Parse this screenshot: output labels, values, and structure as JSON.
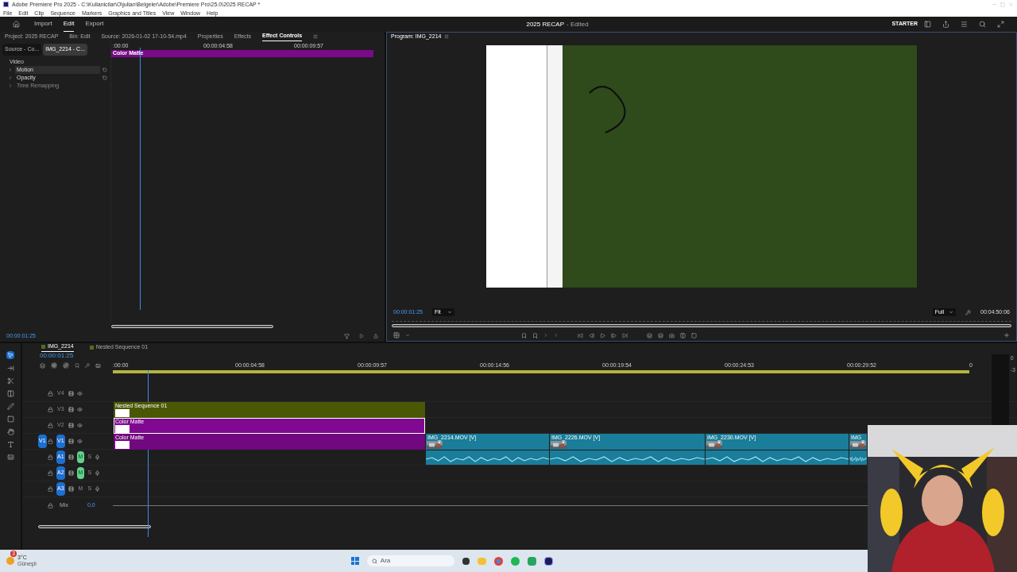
{
  "title_bar": {
    "title": "Adobe Premiere Pro 2025 - C:\\Kullanicilar\\O\\julian\\Belgeler\\Adobe\\Premiere Pro\\25.0\\2025 RECAP *"
  },
  "menu": [
    "File",
    "Edit",
    "Clip",
    "Sequence",
    "Markers",
    "Graphics and Titles",
    "View",
    "Window",
    "Help"
  ],
  "header": {
    "nav": [
      {
        "label": "Import",
        "selected": false
      },
      {
        "label": "Edit",
        "selected": true
      },
      {
        "label": "Export",
        "selected": false
      }
    ],
    "project_title": "2025 RECAP",
    "status": "- Edited",
    "workspace": "STARTER"
  },
  "left_panel": {
    "tabs": [
      {
        "label": "Project: 2025 RECAP",
        "selected": false
      },
      {
        "label": "Bin: Edit",
        "selected": false
      },
      {
        "label": "Source: 2026-01-02 17-10-54.mp4",
        "selected": false
      },
      {
        "label": "Properties",
        "selected": false
      },
      {
        "label": "Effects",
        "selected": false
      },
      {
        "label": "Effect Controls",
        "selected": true
      }
    ],
    "source_tabs": [
      {
        "label": "Source - Co...",
        "selected": false
      },
      {
        "label": "IMG_2214 - C...",
        "selected": true
      }
    ],
    "section": "Video",
    "effects": [
      {
        "name": "Motion",
        "selected": true,
        "enabled": true
      },
      {
        "name": "Opacity",
        "selected": false,
        "enabled": true
      },
      {
        "name": "Time Remapping",
        "selected": false,
        "enabled": false
      }
    ],
    "ruler": [
      ":00:00",
      "00:00:04:58",
      "00:00:09:57"
    ],
    "clip": {
      "name": "Color Matte",
      "color": "#7a0a8a"
    },
    "timecode": "00:00:01:25"
  },
  "program": {
    "title": "Program: IMG_2214",
    "timecode": "00:00:01:25",
    "zoom": "Fit",
    "resolution": "Full",
    "duration": "00:04:50:06"
  },
  "timeline": {
    "tabs": [
      {
        "label": "IMG_2214",
        "selected": true
      },
      {
        "label": "Nested Sequence 01",
        "selected": false
      }
    ],
    "timecode": "00:00:01:25",
    "snap": true,
    "linked": true,
    "ruler": [
      ":00:00",
      "00:00:04:58",
      "00:00:09:57",
      "00:00:14:56",
      "00:00:19:54",
      "00:00:24:53",
      "00:00:29:52",
      "0"
    ],
    "tracks": [
      {
        "label": "V4",
        "kind": "video",
        "targeted": false
      },
      {
        "label": "V3",
        "kind": "video",
        "targeted": false,
        "clips": [
          {
            "name": "Nested Sequence 01",
            "color": "#4a5806",
            "selected": false
          }
        ]
      },
      {
        "label": "V2",
        "kind": "video",
        "targeted": false,
        "clips": [
          {
            "name": "Color Matte",
            "color": "#7f0a8f",
            "selected": true
          }
        ]
      },
      {
        "label": "V1",
        "kind": "video",
        "targeted": true,
        "source": "V1",
        "clips": [
          {
            "name": "Color Matte",
            "color": "#72087f",
            "selected": false
          },
          {
            "name": "IMG_2214.MOV [V]",
            "color": "#1a7d99",
            "selected": false
          },
          {
            "name": "IMG_2226.MOV [V]",
            "color": "#1a7d99",
            "selected": false
          },
          {
            "name": "IMG_2230.MOV [V]",
            "color": "#1a7d99",
            "selected": false
          },
          {
            "name": "IMG_",
            "color": "#1a7d99",
            "selected": false
          }
        ]
      },
      {
        "label": "A1",
        "kind": "audio",
        "targeted": true,
        "mute": "M",
        "solo": "S",
        "muted": true,
        "clips": [
          {
            "color": "#1a7d99",
            "selected": false
          },
          {
            "color": "#1a7d99",
            "selected": false
          },
          {
            "color": "#1a7d99",
            "selected": false
          },
          {
            "color": "#1a7d99",
            "selected": false
          }
        ]
      },
      {
        "label": "A2",
        "kind": "audio",
        "targeted": true,
        "mute": "M",
        "solo": "S",
        "muted": true
      },
      {
        "label": "A3",
        "kind": "audio",
        "targeted": true,
        "mute": "M",
        "solo": "S",
        "muted": false
      }
    ],
    "mix": {
      "label": "Mix",
      "value": "0,0"
    },
    "meter": [
      "0",
      "-3"
    ]
  },
  "taskbar": {
    "temperature": "3°C",
    "weather": "Güneşli",
    "badge": "3",
    "search": "Ara"
  }
}
